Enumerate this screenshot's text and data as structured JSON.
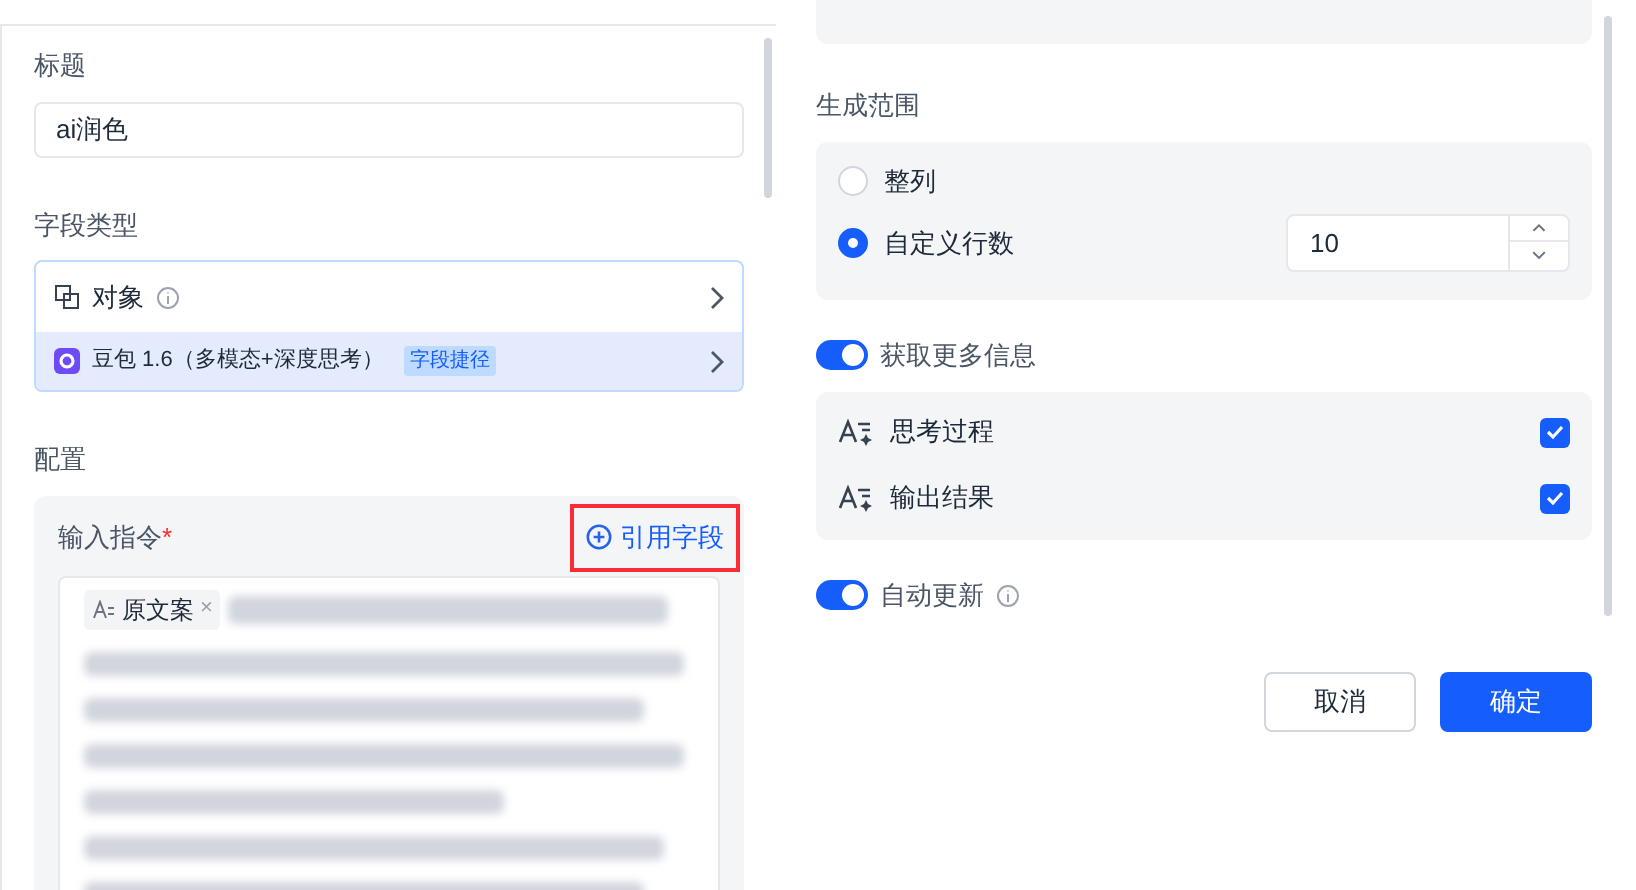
{
  "left": {
    "title_field": {
      "label": "标题",
      "value": "ai润色"
    },
    "field_type": {
      "label": "字段类型",
      "type_name": "对象",
      "model": "豆包 1.6（多模态+深度思考）",
      "badge": "字段捷径"
    },
    "config": {
      "label": "配置",
      "instruction_label": "输入指令",
      "required_mark": "*",
      "ref_button": {
        "label": "引用字段",
        "highlighted": true
      },
      "chip": {
        "label": "原文案",
        "remove": "×"
      }
    }
  },
  "right": {
    "range": {
      "label": "生成范围",
      "options": [
        {
          "label": "整列",
          "selected": false
        },
        {
          "label": "自定义行数",
          "selected": true
        }
      ],
      "row_count": "10"
    },
    "more_info": {
      "label": "获取更多信息",
      "on": true,
      "items": [
        {
          "label": "思考过程",
          "checked": true
        },
        {
          "label": "输出结果",
          "checked": true
        }
      ]
    },
    "auto_update": {
      "label": "自动更新",
      "on": true
    },
    "buttons": [
      "取消",
      "确定"
    ]
  }
}
